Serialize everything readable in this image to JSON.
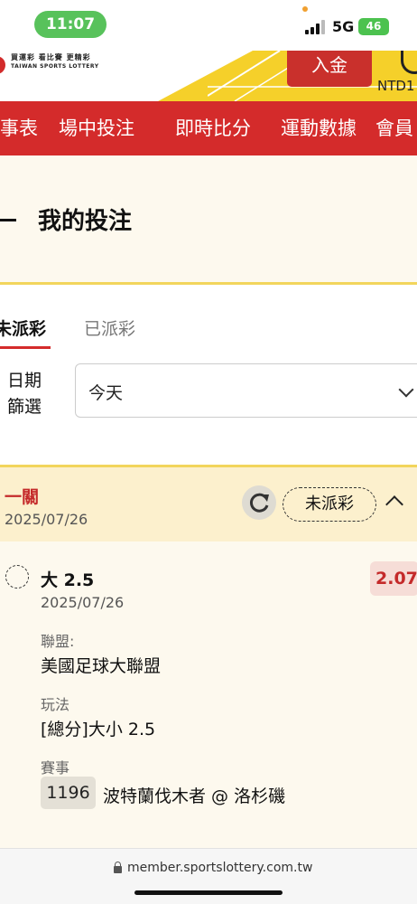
{
  "status_bar": {
    "time": "11:07",
    "network": "5G",
    "battery": "46"
  },
  "header": {
    "logo_cn": "買運彩 看比賽 更精彩",
    "logo_en": "TAIWAN SPORTS LOTTERY",
    "deposit_label": "入金",
    "balance_label": "NTD1"
  },
  "nav": {
    "items": [
      "賽事表",
      "場中投注",
      "即時比分",
      "運動數據",
      "會員"
    ]
  },
  "page": {
    "title": "我的投注"
  },
  "tabs": {
    "unsettled": "未派彩",
    "settled": "已派彩"
  },
  "filter": {
    "label": "日期篩選",
    "value": "今天"
  },
  "bet": {
    "type": "一關",
    "date": "2025/07/26",
    "status": "未派彩",
    "selection": "大 2.5",
    "odds": "2.07",
    "selection_date": "2025/07/26",
    "league_label": "聯盟:",
    "league": "美國足球大聯盟",
    "market_label": "玩法",
    "market": "[總分]大小 2.5",
    "event_label": "賽事",
    "event_id": "1196",
    "event_name": "波特蘭伐木者 @ 洛杉磯"
  },
  "browser": {
    "url": "member.sportslottery.com.tw"
  },
  "colors": {
    "brand_red": "#d42b2b",
    "accent_yellow": "#f2d55c",
    "card_bg": "#fcf0cd"
  }
}
